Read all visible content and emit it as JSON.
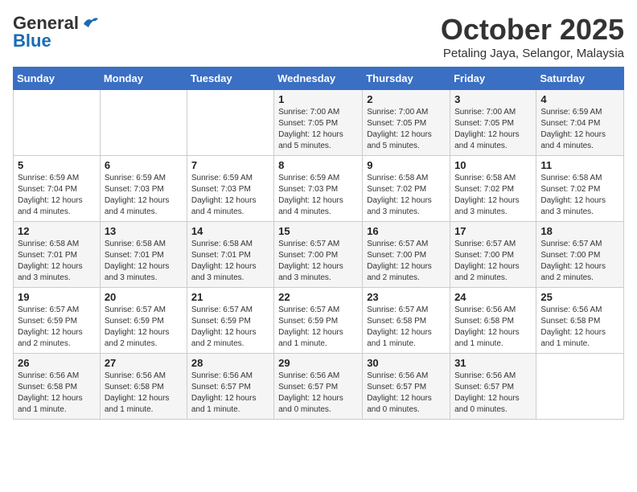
{
  "header": {
    "logo_general": "General",
    "logo_blue": "Blue",
    "month": "October 2025",
    "location": "Petaling Jaya, Selangor, Malaysia"
  },
  "weekdays": [
    "Sunday",
    "Monday",
    "Tuesday",
    "Wednesday",
    "Thursday",
    "Friday",
    "Saturday"
  ],
  "weeks": [
    [
      {
        "day": "",
        "sunrise": "",
        "sunset": "",
        "daylight": ""
      },
      {
        "day": "",
        "sunrise": "",
        "sunset": "",
        "daylight": ""
      },
      {
        "day": "",
        "sunrise": "",
        "sunset": "",
        "daylight": ""
      },
      {
        "day": "1",
        "sunrise": "Sunrise: 7:00 AM",
        "sunset": "Sunset: 7:05 PM",
        "daylight": "Daylight: 12 hours and 5 minutes."
      },
      {
        "day": "2",
        "sunrise": "Sunrise: 7:00 AM",
        "sunset": "Sunset: 7:05 PM",
        "daylight": "Daylight: 12 hours and 5 minutes."
      },
      {
        "day": "3",
        "sunrise": "Sunrise: 7:00 AM",
        "sunset": "Sunset: 7:05 PM",
        "daylight": "Daylight: 12 hours and 4 minutes."
      },
      {
        "day": "4",
        "sunrise": "Sunrise: 6:59 AM",
        "sunset": "Sunset: 7:04 PM",
        "daylight": "Daylight: 12 hours and 4 minutes."
      }
    ],
    [
      {
        "day": "5",
        "sunrise": "Sunrise: 6:59 AM",
        "sunset": "Sunset: 7:04 PM",
        "daylight": "Daylight: 12 hours and 4 minutes."
      },
      {
        "day": "6",
        "sunrise": "Sunrise: 6:59 AM",
        "sunset": "Sunset: 7:03 PM",
        "daylight": "Daylight: 12 hours and 4 minutes."
      },
      {
        "day": "7",
        "sunrise": "Sunrise: 6:59 AM",
        "sunset": "Sunset: 7:03 PM",
        "daylight": "Daylight: 12 hours and 4 minutes."
      },
      {
        "day": "8",
        "sunrise": "Sunrise: 6:59 AM",
        "sunset": "Sunset: 7:03 PM",
        "daylight": "Daylight: 12 hours and 4 minutes."
      },
      {
        "day": "9",
        "sunrise": "Sunrise: 6:58 AM",
        "sunset": "Sunset: 7:02 PM",
        "daylight": "Daylight: 12 hours and 3 minutes."
      },
      {
        "day": "10",
        "sunrise": "Sunrise: 6:58 AM",
        "sunset": "Sunset: 7:02 PM",
        "daylight": "Daylight: 12 hours and 3 minutes."
      },
      {
        "day": "11",
        "sunrise": "Sunrise: 6:58 AM",
        "sunset": "Sunset: 7:02 PM",
        "daylight": "Daylight: 12 hours and 3 minutes."
      }
    ],
    [
      {
        "day": "12",
        "sunrise": "Sunrise: 6:58 AM",
        "sunset": "Sunset: 7:01 PM",
        "daylight": "Daylight: 12 hours and 3 minutes."
      },
      {
        "day": "13",
        "sunrise": "Sunrise: 6:58 AM",
        "sunset": "Sunset: 7:01 PM",
        "daylight": "Daylight: 12 hours and 3 minutes."
      },
      {
        "day": "14",
        "sunrise": "Sunrise: 6:58 AM",
        "sunset": "Sunset: 7:01 PM",
        "daylight": "Daylight: 12 hours and 3 minutes."
      },
      {
        "day": "15",
        "sunrise": "Sunrise: 6:57 AM",
        "sunset": "Sunset: 7:00 PM",
        "daylight": "Daylight: 12 hours and 3 minutes."
      },
      {
        "day": "16",
        "sunrise": "Sunrise: 6:57 AM",
        "sunset": "Sunset: 7:00 PM",
        "daylight": "Daylight: 12 hours and 2 minutes."
      },
      {
        "day": "17",
        "sunrise": "Sunrise: 6:57 AM",
        "sunset": "Sunset: 7:00 PM",
        "daylight": "Daylight: 12 hours and 2 minutes."
      },
      {
        "day": "18",
        "sunrise": "Sunrise: 6:57 AM",
        "sunset": "Sunset: 7:00 PM",
        "daylight": "Daylight: 12 hours and 2 minutes."
      }
    ],
    [
      {
        "day": "19",
        "sunrise": "Sunrise: 6:57 AM",
        "sunset": "Sunset: 6:59 PM",
        "daylight": "Daylight: 12 hours and 2 minutes."
      },
      {
        "day": "20",
        "sunrise": "Sunrise: 6:57 AM",
        "sunset": "Sunset: 6:59 PM",
        "daylight": "Daylight: 12 hours and 2 minutes."
      },
      {
        "day": "21",
        "sunrise": "Sunrise: 6:57 AM",
        "sunset": "Sunset: 6:59 PM",
        "daylight": "Daylight: 12 hours and 2 minutes."
      },
      {
        "day": "22",
        "sunrise": "Sunrise: 6:57 AM",
        "sunset": "Sunset: 6:59 PM",
        "daylight": "Daylight: 12 hours and 1 minute."
      },
      {
        "day": "23",
        "sunrise": "Sunrise: 6:57 AM",
        "sunset": "Sunset: 6:58 PM",
        "daylight": "Daylight: 12 hours and 1 minute."
      },
      {
        "day": "24",
        "sunrise": "Sunrise: 6:56 AM",
        "sunset": "Sunset: 6:58 PM",
        "daylight": "Daylight: 12 hours and 1 minute."
      },
      {
        "day": "25",
        "sunrise": "Sunrise: 6:56 AM",
        "sunset": "Sunset: 6:58 PM",
        "daylight": "Daylight: 12 hours and 1 minute."
      }
    ],
    [
      {
        "day": "26",
        "sunrise": "Sunrise: 6:56 AM",
        "sunset": "Sunset: 6:58 PM",
        "daylight": "Daylight: 12 hours and 1 minute."
      },
      {
        "day": "27",
        "sunrise": "Sunrise: 6:56 AM",
        "sunset": "Sunset: 6:58 PM",
        "daylight": "Daylight: 12 hours and 1 minute."
      },
      {
        "day": "28",
        "sunrise": "Sunrise: 6:56 AM",
        "sunset": "Sunset: 6:57 PM",
        "daylight": "Daylight: 12 hours and 1 minute."
      },
      {
        "day": "29",
        "sunrise": "Sunrise: 6:56 AM",
        "sunset": "Sunset: 6:57 PM",
        "daylight": "Daylight: 12 hours and 0 minutes."
      },
      {
        "day": "30",
        "sunrise": "Sunrise: 6:56 AM",
        "sunset": "Sunset: 6:57 PM",
        "daylight": "Daylight: 12 hours and 0 minutes."
      },
      {
        "day": "31",
        "sunrise": "Sunrise: 6:56 AM",
        "sunset": "Sunset: 6:57 PM",
        "daylight": "Daylight: 12 hours and 0 minutes."
      },
      {
        "day": "",
        "sunrise": "",
        "sunset": "",
        "daylight": ""
      }
    ]
  ]
}
